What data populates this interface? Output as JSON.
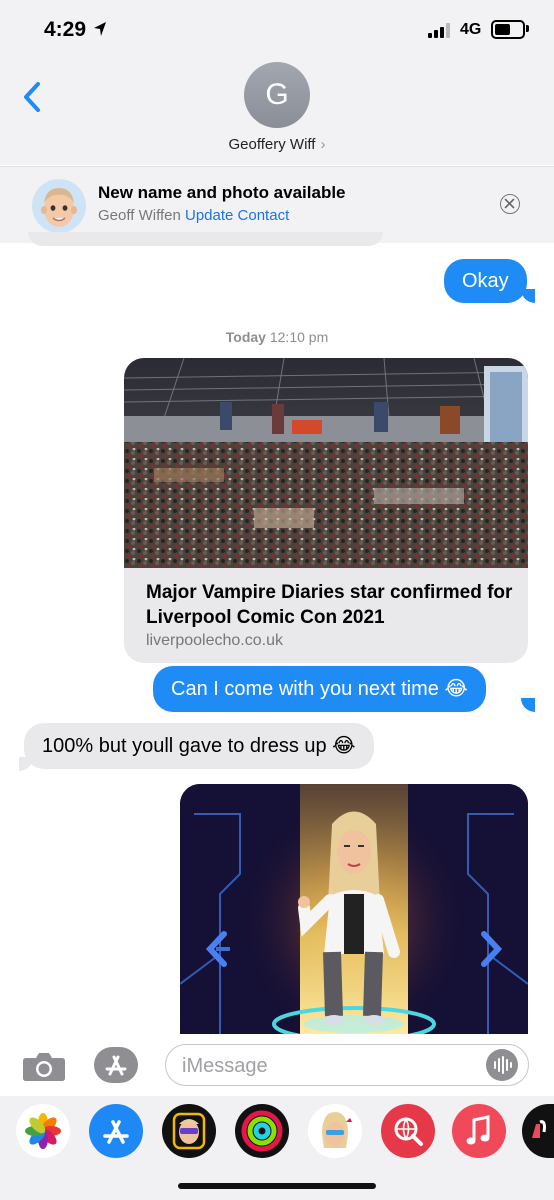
{
  "status_bar": {
    "time": "4:29",
    "network": "4G"
  },
  "header": {
    "avatar_initial": "G",
    "contact_name": "Geoffery Wiff"
  },
  "banner": {
    "title": "New name and photo available",
    "subtitle": "Geoff Wiffen",
    "action_label": "Update Contact"
  },
  "messages": {
    "okay": "Okay",
    "timestamp_day": "Today",
    "timestamp_time": "12:10 pm",
    "link_title": "Major Vampire Diaries star confirmed for Liverpool Comic Con 2021",
    "link_domain": "liverpoolecho.co.uk",
    "question": "Can I come with you next time 😂",
    "reply": "100% but youll gave to dress up 😂"
  },
  "input": {
    "placeholder": "iMessage"
  },
  "colors": {
    "outgoing": "#1f8bf5",
    "incoming": "#e9e9eb",
    "link": "#1a73e8"
  },
  "drawer_apps": [
    "photos-app",
    "app-store-app",
    "memoji-sticker-app",
    "activity-app",
    "memoji-app",
    "web-images-app",
    "music-app",
    "digital-touch-app"
  ]
}
